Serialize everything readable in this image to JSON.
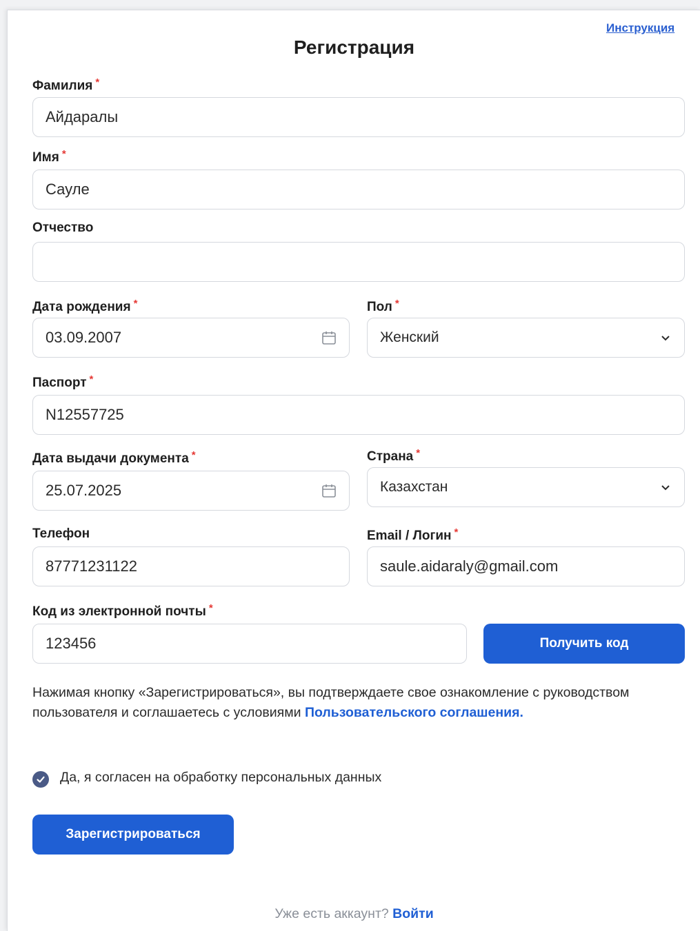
{
  "header": {
    "instructions_link": "Инструкция",
    "title": "Регистрация"
  },
  "form": {
    "last_name": {
      "label": "Фамилия",
      "required": "*",
      "value": "Айдаралы"
    },
    "first_name": {
      "label": "Имя",
      "required": "*",
      "value": "Сауле"
    },
    "middle_name": {
      "label": "Отчество",
      "value": ""
    },
    "birth_date": {
      "label": "Дата рождения",
      "required": "*",
      "value": "03.09.2007",
      "icon": "calendar-icon"
    },
    "gender": {
      "label": "Пол",
      "required": "*",
      "value": "Женский",
      "icon": "chevron-down-icon"
    },
    "passport": {
      "label": "Паспорт",
      "required": "*",
      "value": "N12557725"
    },
    "issue_date": {
      "label": "Дата выдачи документа",
      "required": "*",
      "value": "25.07.2025",
      "icon": "calendar-icon"
    },
    "country": {
      "label": "Страна",
      "required": "*",
      "value": "Казахстан",
      "icon": "chevron-down-icon"
    },
    "phone": {
      "label": "Телефон",
      "value": "87771231122"
    },
    "email": {
      "label": "Email / Логин",
      "required": "*",
      "value": "saule.aidaraly@gmail.com"
    },
    "email_code": {
      "label": "Код из электронной почты",
      "required": "*",
      "value": "123456"
    },
    "get_code_button": "Получить код"
  },
  "notice": {
    "text": "Нажимая кнопку «Зарегистрироваться», вы подтверждаете свое ознакомление с руководством пользователя и соглашаетесь с условиями ",
    "link": "Пользовательского соглашения."
  },
  "consent": {
    "checked": true,
    "label": "Да, я согласен на обработку персональных данных"
  },
  "register_button": "Зарегистрироваться",
  "footer": {
    "text": "Уже есть аккаунт?",
    "link": "Войти"
  },
  "colors": {
    "primary": "#1f5fd4",
    "required": "#e53935",
    "checkbox": "#4a5a86"
  }
}
